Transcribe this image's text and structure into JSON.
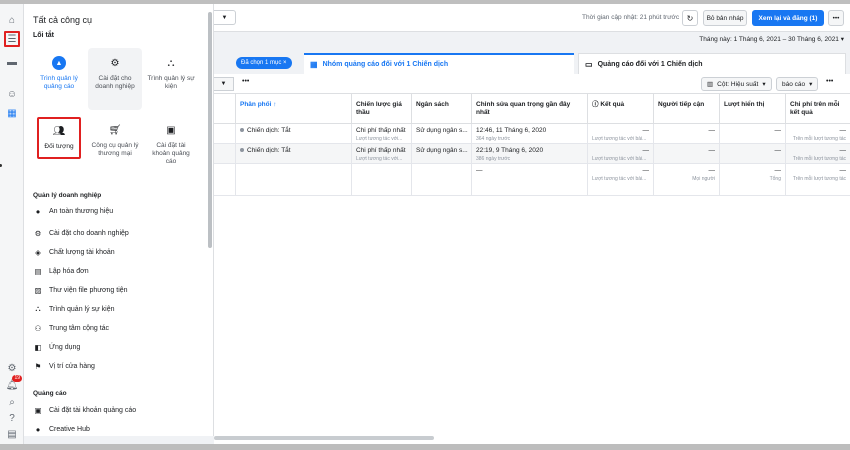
{
  "rail": {
    "icons": [
      "home-icon",
      "menu-icon",
      "ads-icon",
      "smile-icon",
      "grid-icon",
      "settings-icon",
      "bell-icon",
      "search-icon",
      "help-icon",
      "table-icon"
    ],
    "notification_count": "19"
  },
  "panel": {
    "title": "Tất cả công cụ",
    "shortcuts_title": "Lối tắt",
    "tiles": [
      {
        "label": "Trình quản lý quảng cáo",
        "icon": "ads-manager-icon"
      },
      {
        "label": "Cài đặt cho doanh nghiệp",
        "icon": "gear-icon"
      },
      {
        "label": "Trình quản lý sự kiện",
        "icon": "events-icon"
      },
      {
        "label": "Đối tượng",
        "icon": "audience-icon"
      },
      {
        "label": "Công cụ quản lý thương mại",
        "icon": "cart-icon"
      },
      {
        "label": "Cài đặt tài khoản quảng cáo",
        "icon": "account-settings-icon"
      }
    ],
    "business_title": "Quản lý doanh nghiệp",
    "business_items": [
      {
        "label": "An toàn thương hiệu",
        "icon": "shield-icon"
      },
      {
        "label": "Cài đặt cho doanh nghiệp",
        "icon": "gear-icon"
      },
      {
        "label": "Chất lượng tài khoản",
        "icon": "quality-icon"
      },
      {
        "label": "Lập hóa đơn",
        "icon": "invoice-icon"
      },
      {
        "label": "Thư viện file phương tiện",
        "icon": "media-icon"
      },
      {
        "label": "Trình quản lý sự kiện",
        "icon": "events-icon"
      },
      {
        "label": "Trung tâm cộng tác",
        "icon": "collab-icon"
      },
      {
        "label": "Ứng dụng",
        "icon": "apps-icon"
      },
      {
        "label": "Vị trí cửa hàng",
        "icon": "location-icon"
      }
    ],
    "ads_title": "Quảng cáo",
    "ads_items": [
      {
        "label": "Cài đặt tài khoản quảng cáo",
        "icon": "account-settings-icon"
      },
      {
        "label": "Creative Hub",
        "icon": "creative-hub-icon"
      }
    ]
  },
  "topbar": {
    "updated": "Thời gian cập nhật: 21 phút trước",
    "draft_label": "Bỏ bản nháp",
    "publish_label": "Xem lại và đăng (1)",
    "more_label": "•••"
  },
  "daterange": "Tháng này: 1 Tháng 6, 2021 – 30 Tháng 6, 2021",
  "tabs": {
    "chip": "Đã chọn 1 mục ×",
    "active": "Nhóm quảng cáo đối với 1 Chiến dịch",
    "inactive": "Quảng cáo đối với 1 Chiến dịch"
  },
  "toolbar": {
    "columns_label": "Cột: Hiệu suất",
    "report_label": "báo cáo",
    "more_label": "•••"
  },
  "table": {
    "headers": [
      "Phân phối ↑",
      "Chiến lược giá thầu",
      "Ngân sách",
      "Chỉnh sửa quan trọng gần đây nhất",
      "Kết quả",
      "Người tiếp cận",
      "Lượt hiển thị",
      "Chi phí trên mỗi kết quả"
    ],
    "rows": [
      {
        "delivery": "Chiến dịch: Tắt",
        "bid": "Chi phí thấp nhất",
        "bid_sub": "Lượt tương tác với...",
        "budget": "Sử dụng ngân s...",
        "edit": "12:46, 11 Tháng 6, 2020",
        "edit_sub": "364 ngày trước",
        "result": "—",
        "result_sub": "Lượt tương tác với bài...",
        "reach": "—",
        "impr": "—",
        "cpr": "—",
        "cpr_sub": "Trên mỗi lượt tương tác"
      },
      {
        "delivery": "Chiến dịch: Tắt",
        "bid": "Chi phí thấp nhất",
        "bid_sub": "Lượt tương tác với...",
        "budget": "Sử dụng ngân s...",
        "edit": "22:19, 9 Tháng 6, 2020",
        "edit_sub": "386 ngày trước",
        "result": "—",
        "result_sub": "Lượt tương tác với bài...",
        "reach": "—",
        "impr": "—",
        "cpr": "—",
        "cpr_sub": "Trên mỗi lượt tương tác"
      }
    ],
    "total": {
      "edit": "—",
      "result": "—",
      "result_sub": "Lượt tương tác với bài...",
      "reach": "—",
      "reach_sub": "Mọi người",
      "impr": "—",
      "impr_sub": "Tổng",
      "cpr": "—",
      "cpr_sub": "Trên mỗi lượt tương tác"
    }
  }
}
